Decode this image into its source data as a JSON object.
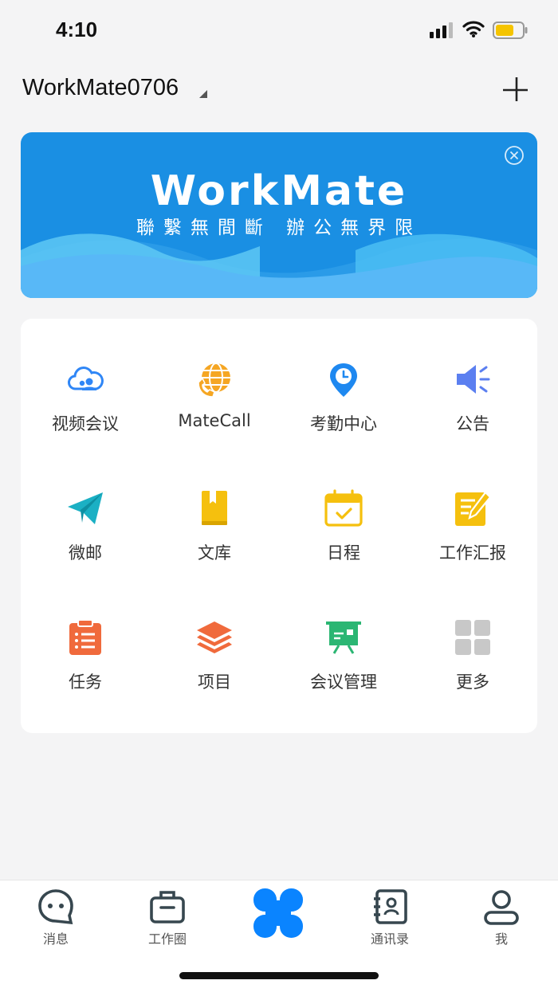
{
  "status_bar": {
    "time": "4:10"
  },
  "header": {
    "org_name": "WorkMate0706"
  },
  "banner": {
    "title": "WorkMate",
    "slogan": "聯繫無間斷 辦公無界限",
    "colors": {
      "background": "#1a8fe3",
      "wave_light": "#5ec8f5",
      "wave_mid": "#3aa5ea"
    }
  },
  "apps": [
    {
      "label": "视频会议",
      "icon": "video-conference-icon",
      "color": "#2f86f6"
    },
    {
      "label": "MateCall",
      "icon": "globe-phone-icon",
      "color": "#f5a623"
    },
    {
      "label": "考勤中心",
      "icon": "location-clock-icon",
      "color": "#1e88f0"
    },
    {
      "label": "公告",
      "icon": "megaphone-icon",
      "color": "#5b7ff0"
    },
    {
      "label": "微邮",
      "icon": "paper-plane-icon",
      "color": "#1bb0c4"
    },
    {
      "label": "文库",
      "icon": "book-icon",
      "color": "#f5c00e"
    },
    {
      "label": "日程",
      "icon": "calendar-icon",
      "color": "#f5c00e"
    },
    {
      "label": "工作汇报",
      "icon": "report-edit-icon",
      "color": "#f5c00e"
    },
    {
      "label": "任务",
      "icon": "clipboard-list-icon",
      "color": "#f06a3c"
    },
    {
      "label": "项目",
      "icon": "layers-icon",
      "color": "#f06a3c"
    },
    {
      "label": "会议管理",
      "icon": "presentation-board-icon",
      "color": "#2bb673"
    },
    {
      "label": "更多",
      "icon": "grid-more-icon",
      "color": "#c8c8c8"
    }
  ],
  "tabbar": {
    "tabs": [
      {
        "label": "消息",
        "icon": "chat-bubble-icon"
      },
      {
        "label": "工作圈",
        "icon": "briefcase-icon"
      },
      {
        "label": "",
        "icon": "workbench-clover-icon",
        "active_color": "#0a84ff"
      },
      {
        "label": "通讯录",
        "icon": "contacts-book-icon"
      },
      {
        "label": "我",
        "icon": "person-icon"
      }
    ]
  }
}
